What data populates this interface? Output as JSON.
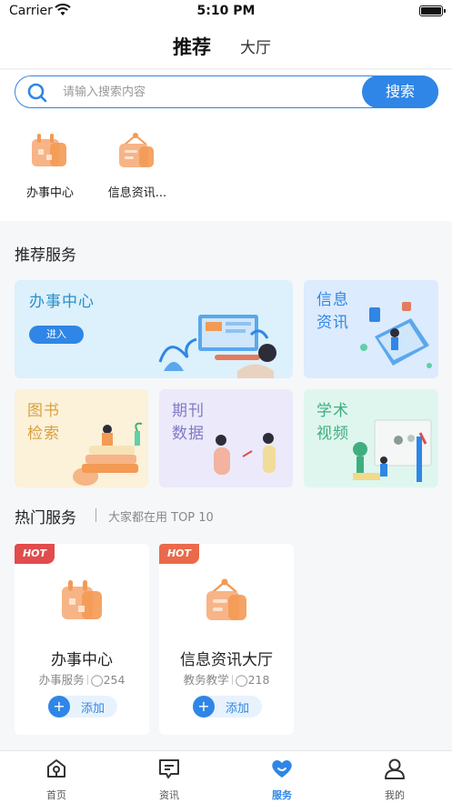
{
  "status_bar": {
    "carrier": "Carrier",
    "time": "5:10 PM"
  },
  "top_nav": {
    "tabs": [
      {
        "label": "推荐"
      },
      {
        "label": "大厅"
      }
    ]
  },
  "search": {
    "placeholder": "请输入搜索内容",
    "value": "",
    "button_label": "搜索"
  },
  "quick_links": [
    {
      "label": "办事中心",
      "icon": "calendar-icon"
    },
    {
      "label": "信息资讯...",
      "icon": "sign-icon"
    }
  ],
  "recommended": {
    "title": "推荐服务",
    "cards": [
      {
        "title": "办事中心",
        "button": "进入"
      },
      {
        "title": "信息资讯"
      },
      {
        "title": "图书检索"
      },
      {
        "title": "期刊数据"
      },
      {
        "title": "学术视频"
      }
    ]
  },
  "hot": {
    "title": "热门服务",
    "subtitle": "大家都在用 TOP 10",
    "items": [
      {
        "badge": "HOT",
        "name": "办事中心",
        "category": "办事服务",
        "count": "254",
        "add_label": "添加"
      },
      {
        "badge": "HOT",
        "name": "信息资讯大厅",
        "category": "教务教学",
        "count": "218",
        "add_label": "添加"
      }
    ]
  },
  "bottom_nav": [
    {
      "label": "首页",
      "icon": "home-icon"
    },
    {
      "label": "资讯",
      "icon": "news-icon"
    },
    {
      "label": "服务",
      "icon": "heart-icon",
      "active": true
    },
    {
      "label": "我的",
      "icon": "profile-icon"
    }
  ],
  "colors": {
    "accent": "#2f86e6",
    "hot_badge": "#e14c4c",
    "orange_icon": "#f39a54"
  }
}
